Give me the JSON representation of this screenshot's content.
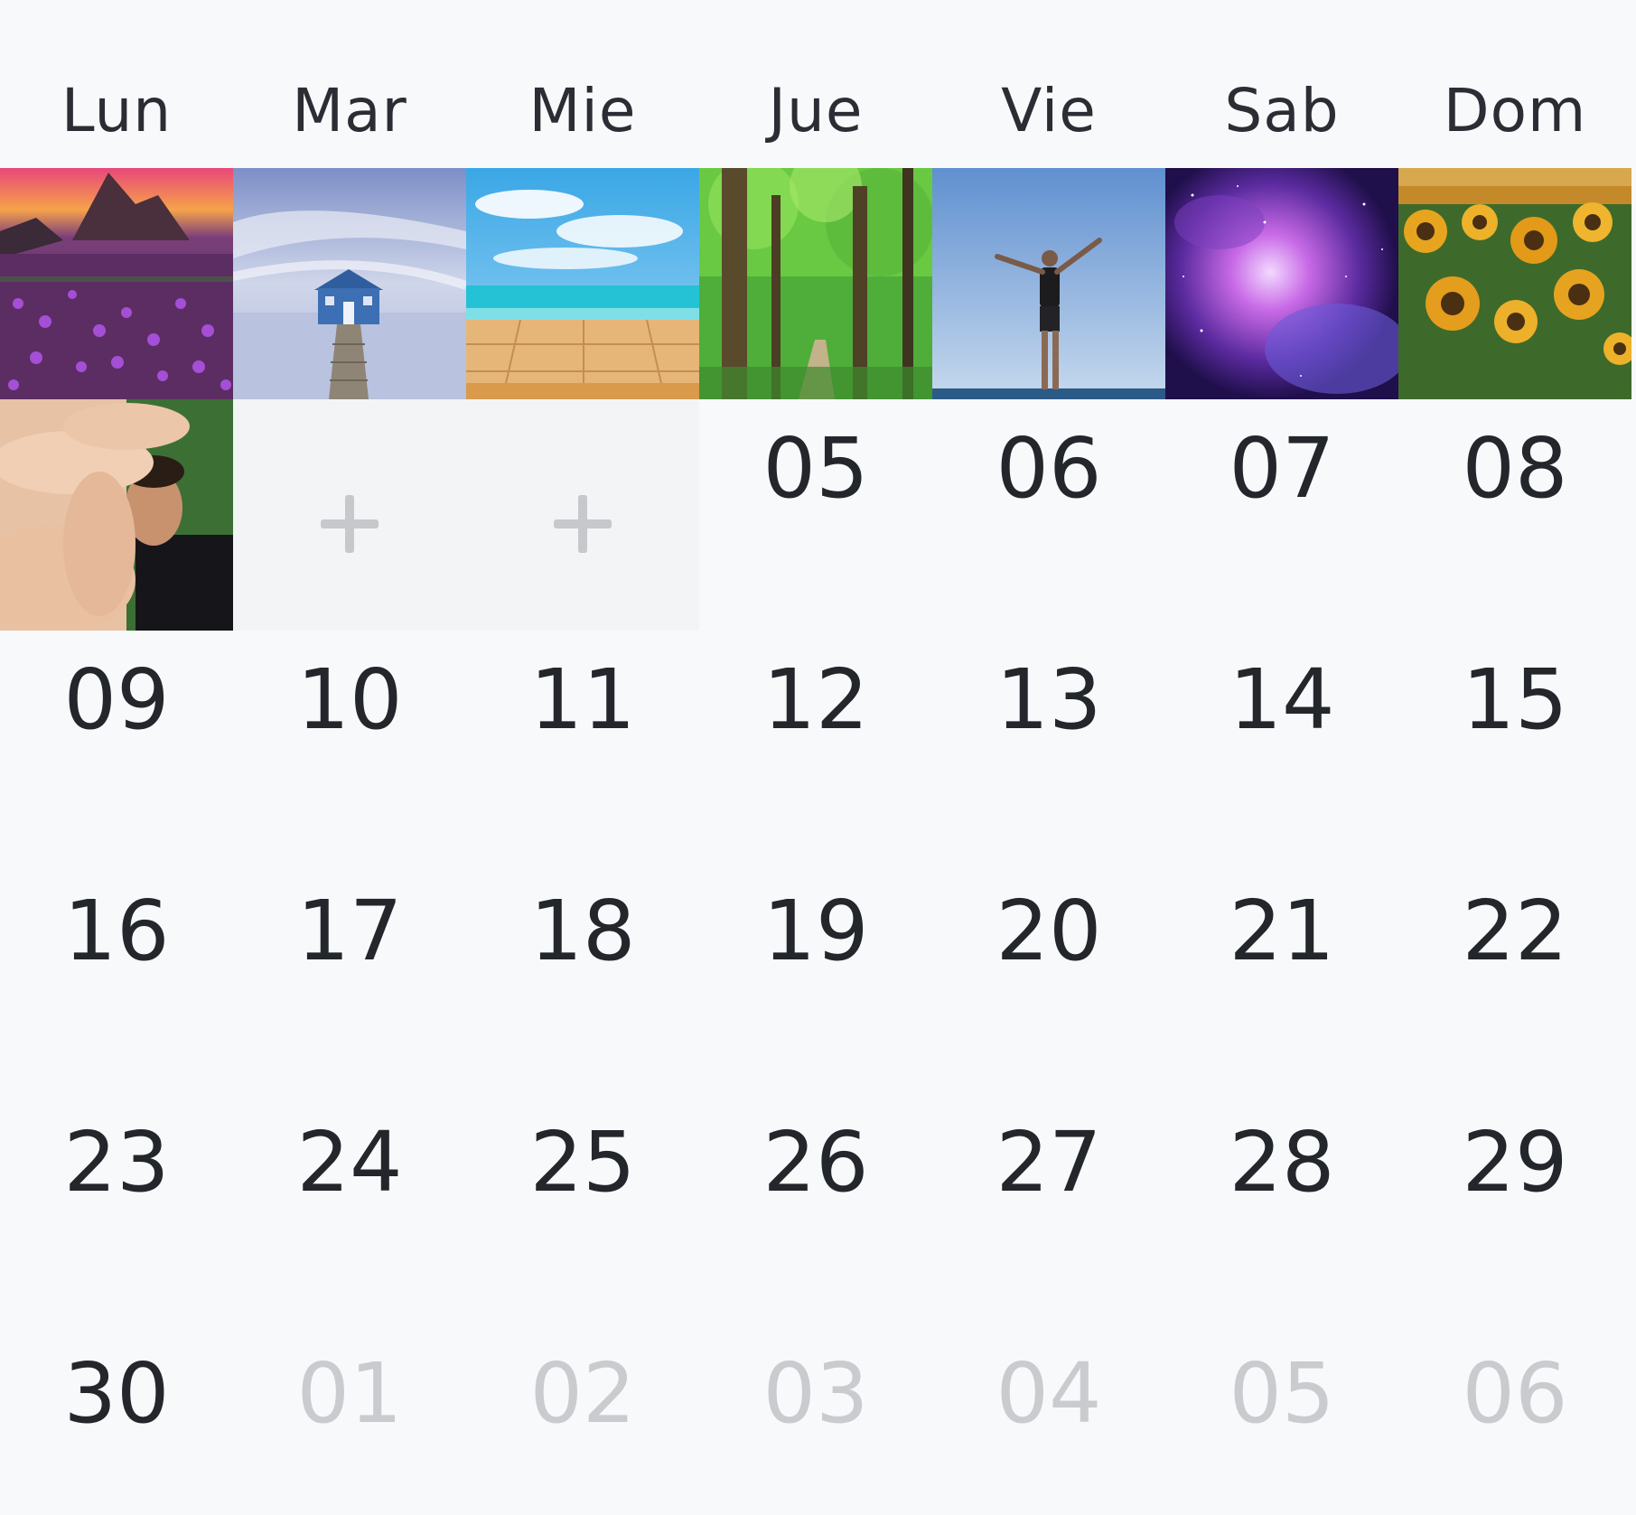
{
  "calendar": {
    "weekdays": [
      "Lun",
      "Mar",
      "Mie",
      "Jue",
      "Vie",
      "Sab",
      "Dom"
    ],
    "weeks": [
      [
        {
          "kind": "photo",
          "photo": "coastal-sunset-flowers-photo"
        },
        {
          "kind": "photo",
          "photo": "boathouse-pier-photo"
        },
        {
          "kind": "photo",
          "photo": "beach-boardwalk-photo"
        },
        {
          "kind": "photo",
          "photo": "forest-path-photo"
        },
        {
          "kind": "photo",
          "photo": "man-arms-raised-photo"
        },
        {
          "kind": "photo",
          "photo": "purple-galaxy-photo"
        },
        {
          "kind": "photo",
          "photo": "sunflower-field-photo"
        }
      ],
      [
        {
          "kind": "photo",
          "photo": "selfie-hand-photo"
        },
        {
          "kind": "add"
        },
        {
          "kind": "add"
        },
        {
          "kind": "day",
          "label": "05"
        },
        {
          "kind": "day",
          "label": "06"
        },
        {
          "kind": "day",
          "label": "07"
        },
        {
          "kind": "day",
          "label": "08"
        }
      ],
      [
        {
          "kind": "day",
          "label": "09"
        },
        {
          "kind": "day",
          "label": "10"
        },
        {
          "kind": "day",
          "label": "11"
        },
        {
          "kind": "day",
          "label": "12"
        },
        {
          "kind": "day",
          "label": "13"
        },
        {
          "kind": "day",
          "label": "14"
        },
        {
          "kind": "day",
          "label": "15"
        }
      ],
      [
        {
          "kind": "day",
          "label": "16"
        },
        {
          "kind": "day",
          "label": "17"
        },
        {
          "kind": "day",
          "label": "18"
        },
        {
          "kind": "day",
          "label": "19"
        },
        {
          "kind": "day",
          "label": "20"
        },
        {
          "kind": "day",
          "label": "21"
        },
        {
          "kind": "day",
          "label": "22"
        }
      ],
      [
        {
          "kind": "day",
          "label": "23"
        },
        {
          "kind": "day",
          "label": "24"
        },
        {
          "kind": "day",
          "label": "25"
        },
        {
          "kind": "day",
          "label": "26"
        },
        {
          "kind": "day",
          "label": "27"
        },
        {
          "kind": "day",
          "label": "28"
        },
        {
          "kind": "day",
          "label": "29"
        }
      ],
      [
        {
          "kind": "day",
          "label": "30"
        },
        {
          "kind": "day",
          "label": "01",
          "other_month": true
        },
        {
          "kind": "day",
          "label": "02",
          "other_month": true
        },
        {
          "kind": "day",
          "label": "03",
          "other_month": true
        },
        {
          "kind": "day",
          "label": "04",
          "other_month": true
        },
        {
          "kind": "day",
          "label": "05",
          "other_month": true
        },
        {
          "kind": "day",
          "label": "06",
          "other_month": true
        }
      ]
    ]
  },
  "colors": {
    "background": "#f8f9fb",
    "text": "#23262b",
    "muted_text": "#c9cbcf",
    "add_cell": "#f3f4f6",
    "add_icon": "#c6c8cc"
  }
}
